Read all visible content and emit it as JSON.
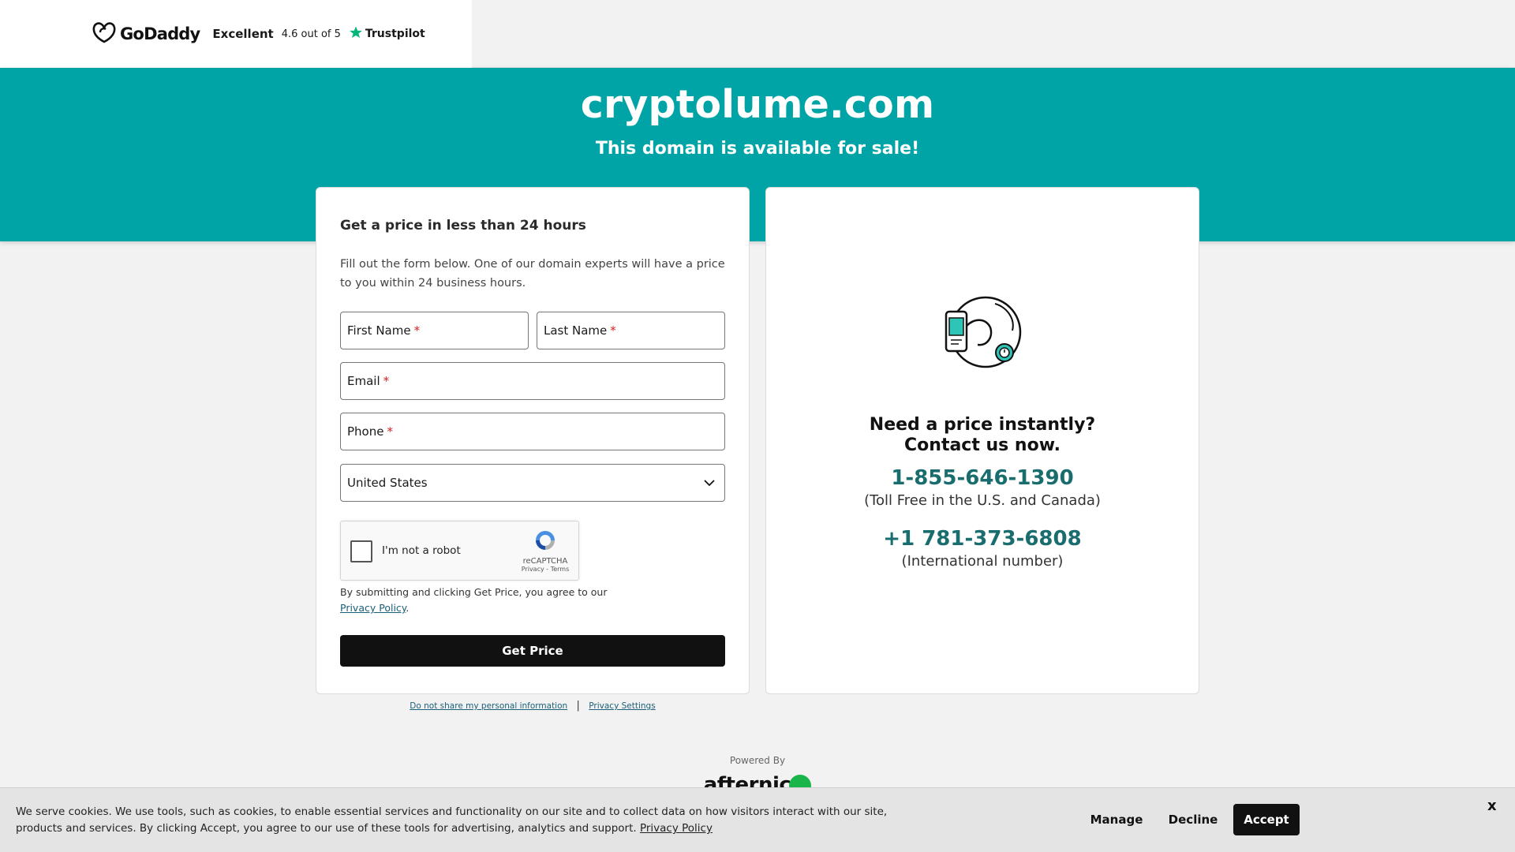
{
  "header": {
    "brand": "GoDaddy",
    "trustpilot_rating_word": "Excellent",
    "trustpilot_score": "4.6 out of 5",
    "trustpilot_brand": "Trustpilot"
  },
  "hero": {
    "domain": "cryptolume.com",
    "subtitle": "This domain is available for sale!"
  },
  "form": {
    "title": "Get a price in less than 24 hours",
    "description": "Fill out the form below. One of our domain experts will have a price to you within 24 business hours.",
    "first_name_label": "First Name",
    "last_name_label": "Last Name",
    "email_label": "Email",
    "phone_label": "Phone",
    "required_marker": "*",
    "country_value": "United States",
    "recaptcha_label": "I'm not a robot",
    "recaptcha_brand": "reCAPTCHA",
    "recaptcha_links": "Privacy - Terms",
    "consent_text": "By submitting and clicking Get Price, you agree to our",
    "consent_link": "Privacy Policy",
    "consent_end": ".",
    "submit_label": "Get Price"
  },
  "footer_links": {
    "do_not_share": "Do not share my personal information",
    "separator": "|",
    "privacy_settings": "Privacy Settings"
  },
  "powered_by": {
    "label": "Powered By",
    "brand": "afternic"
  },
  "contact": {
    "heading_line1": "Need a price instantly?",
    "heading_line2": "Contact us now.",
    "phone_tollfree": "1-855-646-1390",
    "phone_tollfree_note": "(Toll Free in the U.S. and Canada)",
    "phone_international": "+1 781-373-6808",
    "phone_international_note": "(International number)"
  },
  "cookie_banner": {
    "text": "We serve cookies. We use tools, such as cookies, to enable essential services and functionality on our site and to collect data on how visitors interact with our site, products and services. By clicking Accept, you agree to our use of these tools for advertising, analytics and support.",
    "policy_link": "Privacy Policy",
    "manage_label": "Manage",
    "decline_label": "Decline",
    "accept_label": "Accept",
    "close_label": "x"
  },
  "colors": {
    "hero_teal": "#00a4a6",
    "phone_teal": "#1a6d6e",
    "trustpilot_green": "#00b67a",
    "button_black": "#111111"
  },
  "icons": [
    "godaddy-logo-icon",
    "trustpilot-star-icon",
    "chevron-down-icon",
    "recaptcha-icon",
    "contact-illustration-icon",
    "afternic-logo-icon"
  ]
}
